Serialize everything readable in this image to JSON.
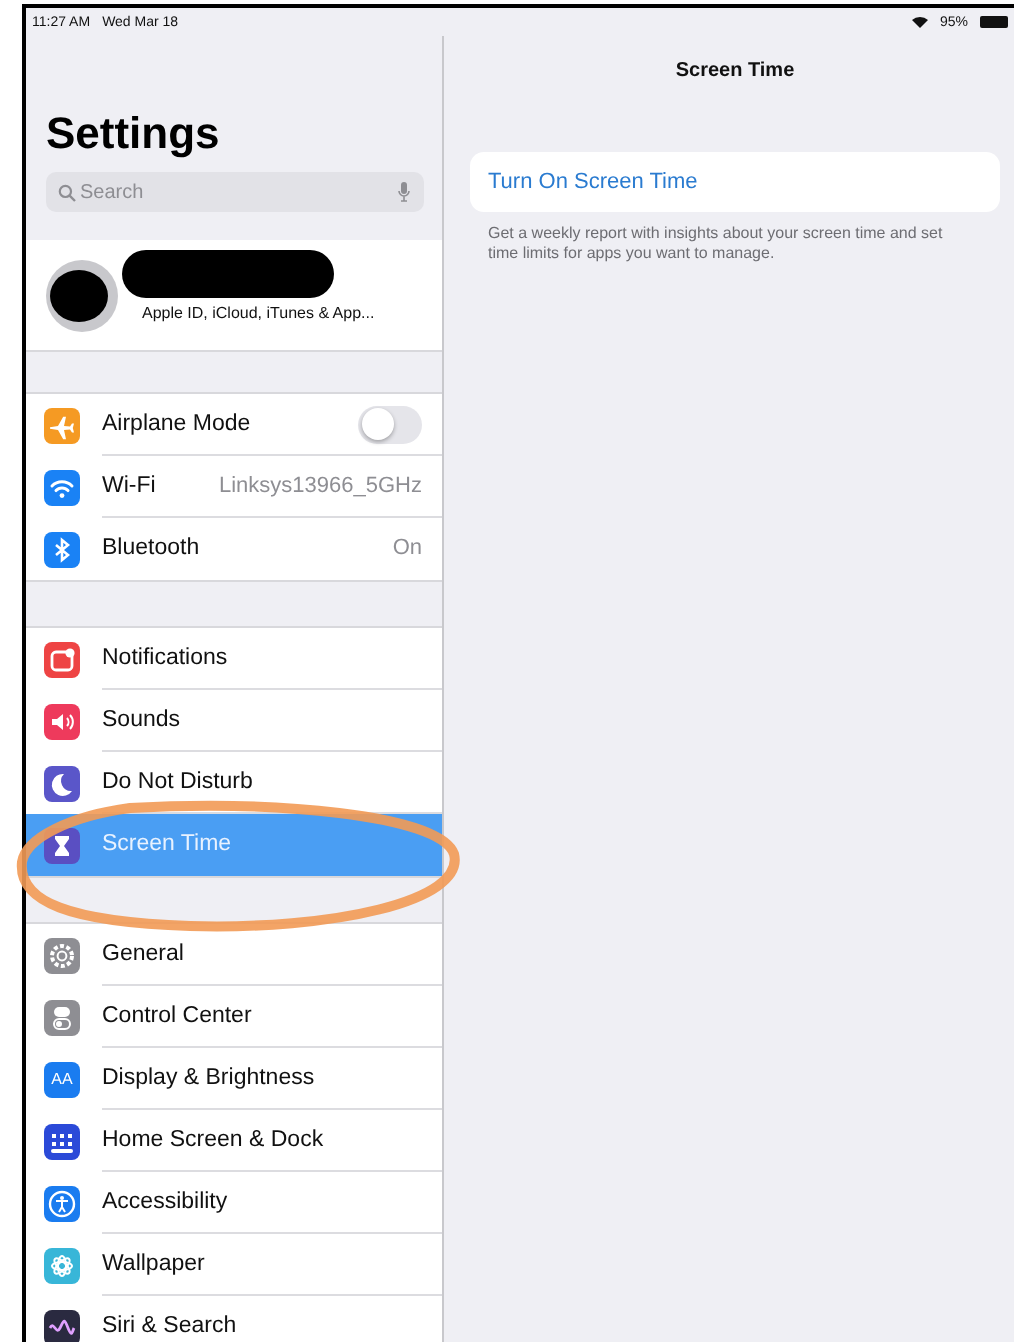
{
  "status_bar": {
    "time": "11:27 AM",
    "date": "Wed Mar 18",
    "battery": "95%"
  },
  "sidebar": {
    "title": "Settings",
    "search": {
      "placeholder": "Search"
    },
    "account": {
      "subtitle": "Apple ID, iCloud, iTunes & App..."
    },
    "groups": [
      {
        "items": [
          {
            "label": "Airplane Mode",
            "kind": "toggle",
            "on": false,
            "color": "#f59a23",
            "selected": false
          },
          {
            "label": "Wi-Fi",
            "kind": "value",
            "value": "Linksys13966_5GHz",
            "color": "#1a82f5",
            "selected": false
          },
          {
            "label": "Bluetooth",
            "kind": "value",
            "value": "On",
            "color": "#1a82f5",
            "selected": false
          }
        ]
      },
      {
        "items": [
          {
            "label": "Notifications",
            "kind": "link",
            "color": "#ee4444",
            "selected": false
          },
          {
            "label": "Sounds",
            "kind": "link",
            "color": "#ee3a5c",
            "selected": false
          },
          {
            "label": "Do Not Disturb",
            "kind": "link",
            "color": "#5a56c9",
            "selected": false
          },
          {
            "label": "Screen Time",
            "kind": "link",
            "color": "#5a4fc2",
            "selected": true
          }
        ]
      },
      {
        "items": [
          {
            "label": "General",
            "kind": "link",
            "color": "#8e8e93",
            "selected": false
          },
          {
            "label": "Control Center",
            "kind": "link",
            "color": "#8e8e93",
            "selected": false
          },
          {
            "label": "Display & Brightness",
            "kind": "link",
            "color": "#1a7cf0",
            "selected": false,
            "icon_text": "AA"
          },
          {
            "label": "Home Screen & Dock",
            "kind": "link",
            "color": "#2b4ad8",
            "selected": false
          },
          {
            "label": "Accessibility",
            "kind": "link",
            "color": "#1a7cf0",
            "selected": false
          },
          {
            "label": "Wallpaper",
            "kind": "link",
            "color": "#38b6d8",
            "selected": false
          },
          {
            "label": "Siri & Search",
            "kind": "link",
            "color": "#2a2a40",
            "selected": false
          }
        ]
      }
    ]
  },
  "detail": {
    "title": "Screen Time",
    "action": "Turn On Screen Time",
    "footer": "Get a weekly report with insights about your screen time and set time limits for apps you want to manage."
  }
}
